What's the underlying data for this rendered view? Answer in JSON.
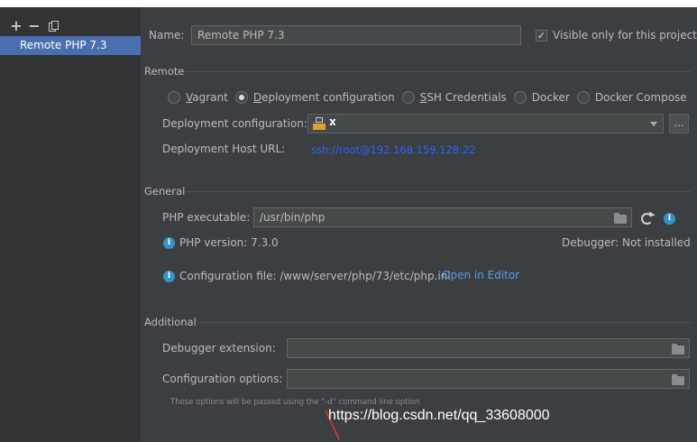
{
  "left_panel": {
    "toolbar": {
      "add": "+",
      "remove": "−"
    },
    "items": [
      {
        "label": "Remote PHP 7.3"
      }
    ]
  },
  "name_row": {
    "label": "Name:",
    "value": "Remote PHP 7.3",
    "visible_only_checked": true,
    "visible_only_label": "Visible only for this project"
  },
  "remote": {
    "title": "Remote",
    "options": [
      {
        "label": "Vagrant",
        "mnemonic": "V",
        "rest": "agrant",
        "selected": false
      },
      {
        "label": "Deployment configuration",
        "mnemonic": "D",
        "rest": "eployment configuration",
        "selected": true
      },
      {
        "label": "SSH Credentials",
        "mnemonic": "S",
        "rest": "SH Credentials",
        "selected": false
      },
      {
        "label": "Docker",
        "selected": false
      },
      {
        "label": "Docker Compose",
        "selected": false
      }
    ],
    "deployment_config_label": "Deployment configuration:",
    "deployment_config_value": "x",
    "browse_label": "...",
    "host_url_label": "Deployment Host URL:",
    "host_url_value": "ssh://root@192.168.159.128:22"
  },
  "general": {
    "title": "General",
    "php_exec_label": "PHP executable:",
    "php_exec_value": "/usr/bin/php",
    "php_version": "PHP version: 7.3.0",
    "debugger": "Debugger: Not installed",
    "config_file": "Configuration file: /www/server/php/73/etc/php.ini",
    "open_in_editor": "Open in Editor"
  },
  "additional": {
    "title": "Additional",
    "debugger_ext_label": "Debugger extension:",
    "debugger_ext_value": "",
    "config_options_label": "Configuration options:",
    "config_options_value": "",
    "hint": "These options will be passed using the \"-d\" command line option"
  },
  "watermark": "https://blog.csdn.net/qq_33608000",
  "colors": {
    "selection": "#4b6eaf",
    "link": "#589df6",
    "url": "#2e62ff",
    "info": "#3592c4"
  }
}
